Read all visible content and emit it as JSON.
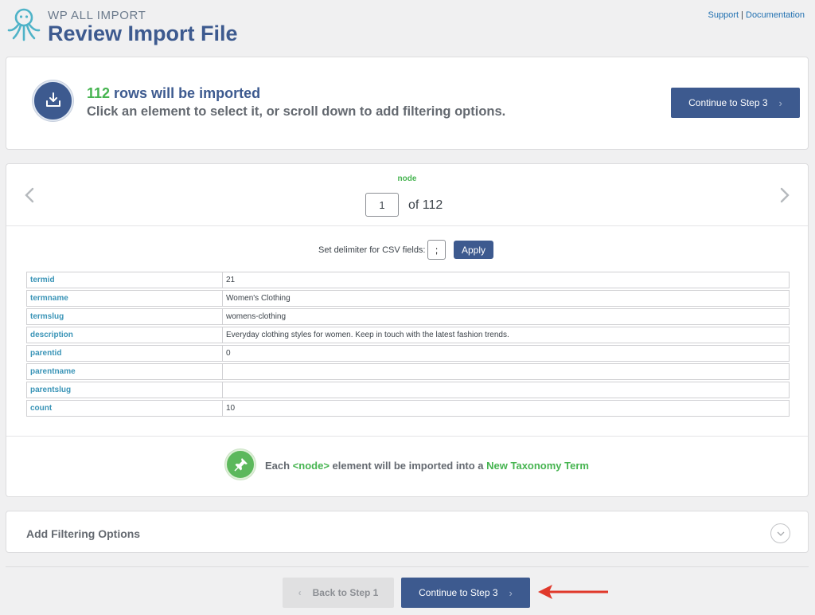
{
  "header": {
    "brand": "WP ALL IMPORT",
    "title": "Review Import File",
    "support_link": "Support",
    "separator": "|",
    "documentation_link": "Documentation",
    "logo_icon": "octopus-logo-icon"
  },
  "summary": {
    "rows_count": "112",
    "rows_text": " rows will be imported",
    "hint": "Click an element to select it, or scroll down to add filtering options.",
    "continue_label": "Continue to Step 3",
    "icon": "download-tray-icon"
  },
  "node_viewer": {
    "node_label": "node",
    "current_page": "1",
    "of_text": "of 112",
    "prev_icon": "chevron-left-icon",
    "next_icon": "chevron-right-icon"
  },
  "delimiter": {
    "label": "Set delimiter for CSV fields:",
    "value": ";",
    "apply_label": "Apply"
  },
  "fields": [
    {
      "key": "termid",
      "value": "21"
    },
    {
      "key": "termname",
      "value": "Women's Clothing"
    },
    {
      "key": "termslug",
      "value": "womens-clothing"
    },
    {
      "key": "description",
      "value": "Everyday clothing styles for women. Keep in touch with the latest fashion trends."
    },
    {
      "key": "parentid",
      "value": "0"
    },
    {
      "key": "parentname",
      "value": ""
    },
    {
      "key": "parentslug",
      "value": ""
    },
    {
      "key": "count",
      "value": "10"
    }
  ],
  "import_note": {
    "prefix": "Each ",
    "element": "<node>",
    "middle": " element will be imported into a ",
    "target": "New Taxonomy Term",
    "icon": "pushpin-icon"
  },
  "filtering": {
    "title": "Add Filtering Options",
    "expand_icon": "chevron-down-icon"
  },
  "footer": {
    "back_label": "Back to Step 1",
    "continue_label": "Continue to Step 3"
  },
  "colors": {
    "primary": "#3d5a8f",
    "green": "#46b450",
    "field_key": "#3a94b7",
    "annotation_arrow": "#e0392b"
  }
}
